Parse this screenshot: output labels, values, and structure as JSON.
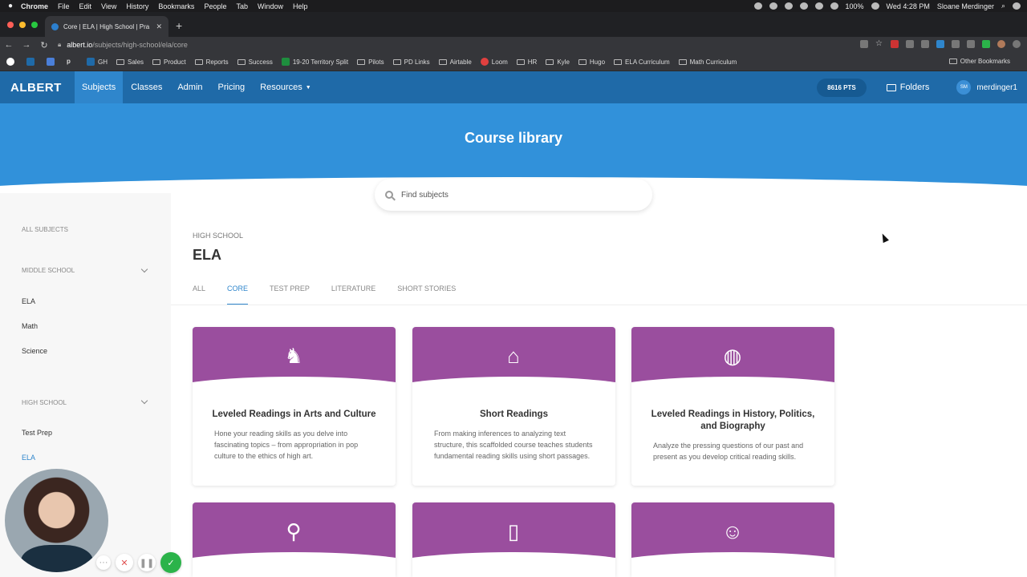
{
  "mac_menu": {
    "apple": "",
    "items": [
      "Chrome",
      "File",
      "Edit",
      "View",
      "History",
      "Bookmarks",
      "People",
      "Tab",
      "Window",
      "Help"
    ],
    "battery": "100%",
    "clock": "Wed 4:28 PM",
    "user": "Sloane Merdinger"
  },
  "browser": {
    "tab_title": "Core | ELA | High School | Pra",
    "new_tab": "+",
    "url_host": "albert.io",
    "url_path": "/subjects/high-school/ela/core",
    "bookmarks": [
      "GH",
      "Sales",
      "Product",
      "Reports",
      "Success",
      "19-20 Territory Split",
      "Pilots",
      "PD Links",
      "Airtable",
      "Loom",
      "HR",
      "Kyle",
      "Hugo",
      "ELA Curriculum",
      "Math Curriculum"
    ],
    "other_bookmarks": "Other Bookmarks"
  },
  "nav": {
    "logo": "ALBERT",
    "items": [
      "Subjects",
      "Classes",
      "Admin",
      "Pricing",
      "Resources"
    ],
    "points": "8616 PTS",
    "folders": "Folders",
    "user_initials": "SM",
    "username": "merdinger1"
  },
  "hero": {
    "title": "Course library",
    "search_placeholder": "Find subjects"
  },
  "sidebar": {
    "all_subjects": "ALL SUBJECTS",
    "middle_school": "MIDDLE SCHOOL",
    "middle_items": [
      "ELA",
      "Math",
      "Science"
    ],
    "high_school": "HIGH SCHOOL",
    "high_items": [
      "Test Prep",
      "ELA"
    ]
  },
  "main": {
    "crumb": "HIGH SCHOOL",
    "title": "ELA",
    "tabs": [
      "ALL",
      "CORE",
      "TEST PREP",
      "LITERATURE",
      "SHORT STORIES"
    ],
    "cards": [
      {
        "title": "Leveled Readings in Arts and Culture",
        "desc": "Hone your reading skills as you delve into fascinating topics – from appropriation in pop culture to the ethics of high art.",
        "icon": "thinker-statue-icon"
      },
      {
        "title": "Short Readings",
        "desc": "From making inferences to analyzing text structure, this scaffolded course teaches students fundamental reading skills using short passages.",
        "icon": "house-document-icon"
      },
      {
        "title": "Leveled Readings in History, Politics, and Biography",
        "desc": "Analyze the pressing questions of our past and present as you develop critical reading skills.",
        "icon": "globe-book-icon"
      },
      {
        "icon": "satellite-dish-icon"
      },
      {
        "icon": "open-book-icon"
      },
      {
        "icon": "face-thought-icon"
      }
    ]
  },
  "colors": {
    "nav": "#1f6aa8",
    "hero": "#3191da",
    "accent": "#2f86cc",
    "card_header": "#9a4e9e"
  }
}
